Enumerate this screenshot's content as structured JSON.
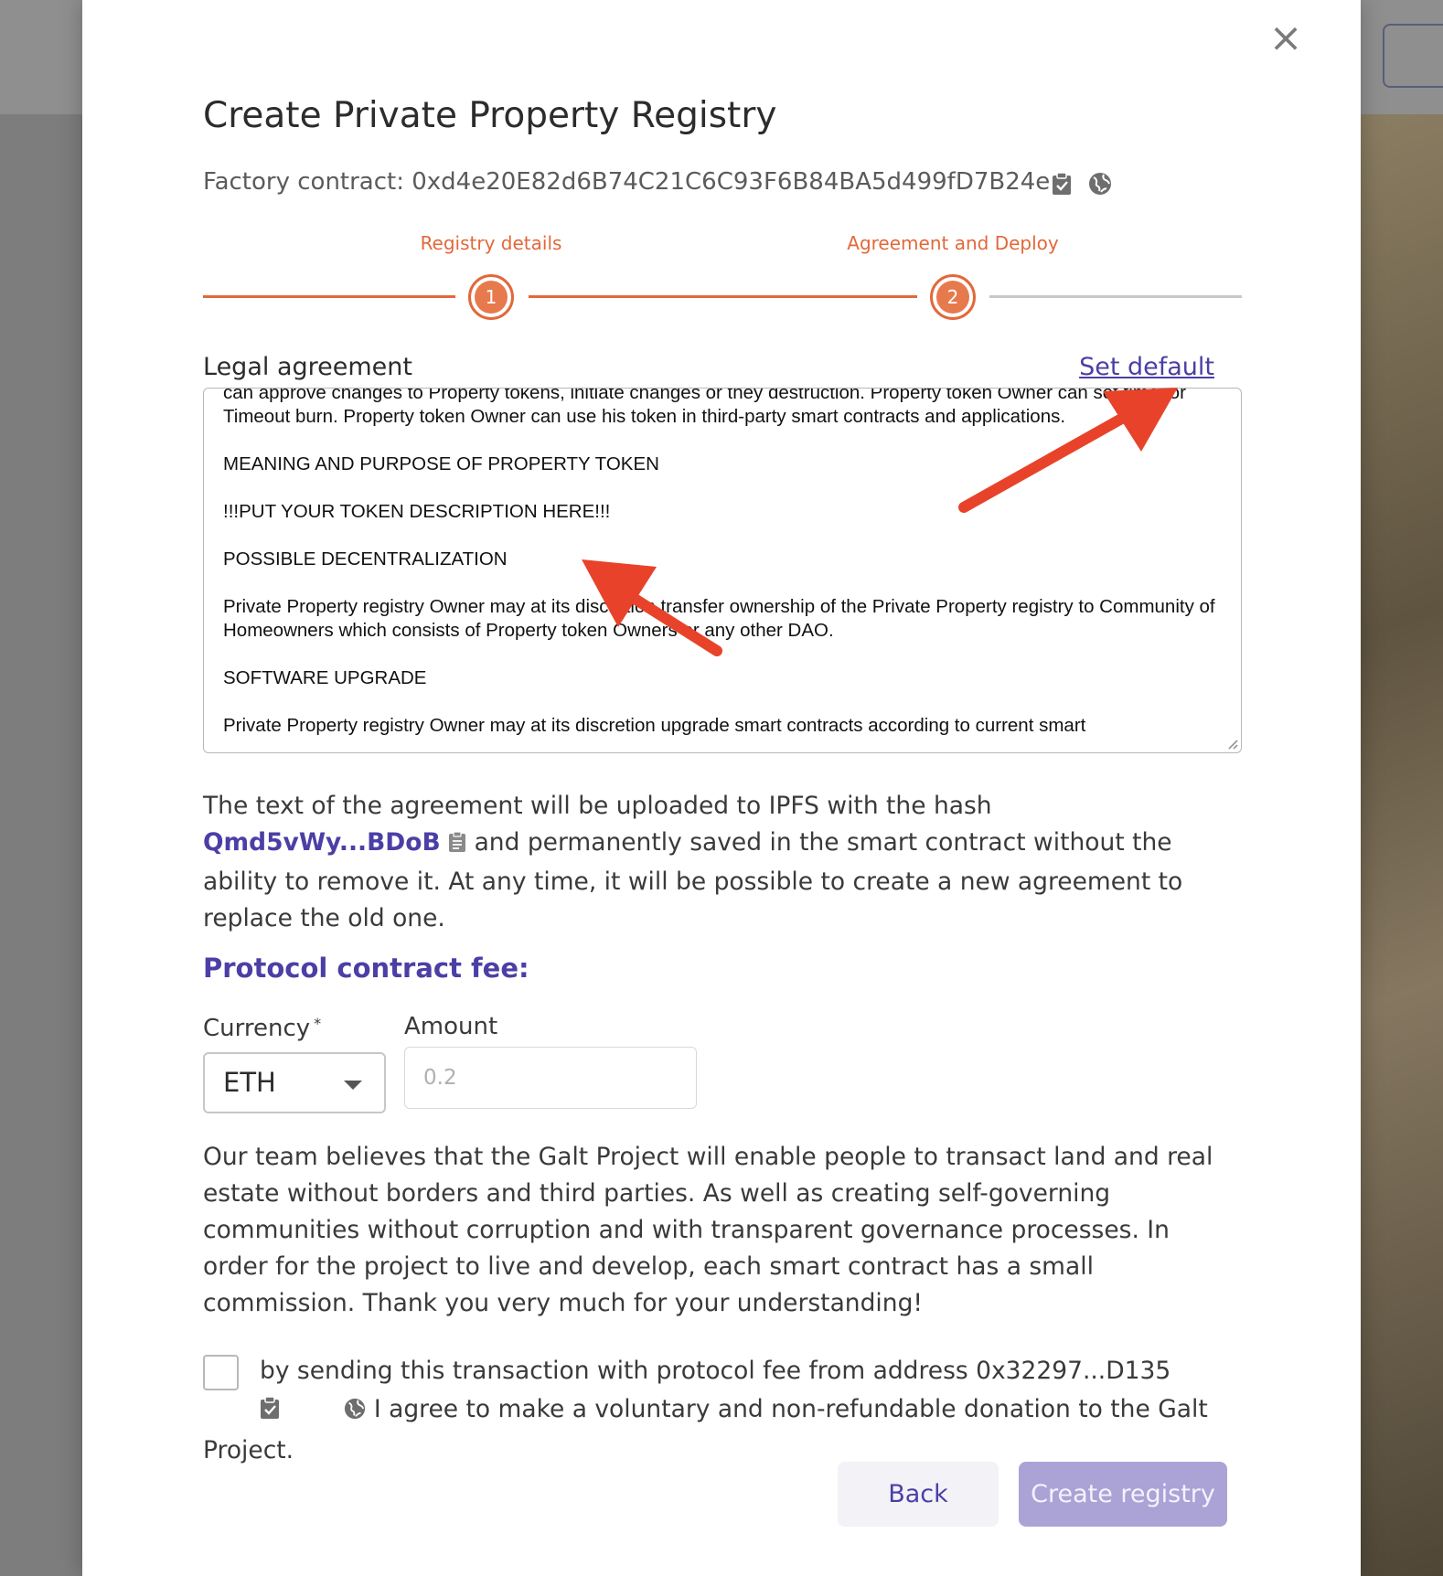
{
  "modal": {
    "title": "Create Private Property Registry",
    "factory_contract": "Factory contract: 0xd4e20E82d6B74C21C6C93F6B84BA5d499fD7B24e",
    "copy_icon": "clipboard-check-icon",
    "explorer_icon": "globe-icon",
    "close_icon": "close-icon",
    "close_glyph": "×"
  },
  "stepper": {
    "steps": [
      {
        "label": "Registry details",
        "number": "1"
      },
      {
        "label": "Agreement and Deploy",
        "number": "2"
      }
    ],
    "active_step": 2,
    "accent_color": "#e2683a"
  },
  "agreement": {
    "label": "Legal agreement",
    "set_default": "Set default",
    "paragraphs": [
      "can approve changes to Property tokens, initiate changes or they destruction. Property token Owner can set time for Timeout burn. Property token Owner can use his token in third-party smart contracts and applications.",
      "MEANING AND PURPOSE OF PROPERTY TOKEN",
      "!!!PUT YOUR TOKEN DESCRIPTION HERE!!!",
      "POSSIBLE DECENTRALIZATION",
      "Private Property registry Owner may at its discretion transfer ownership of the Private Property registry to Community of Homeowners which consists of Property token Owners or any other DAO.",
      "SOFTWARE UPGRADE",
      "Private Property registry Owner may at its discretion upgrade smart contracts according to current smart"
    ],
    "ipfs_prefix": "The text of the agreement will be uploaded to IPFS with the hash ",
    "ipfs_hash": "Qmd5vWy...BDoB",
    "ipfs_suffix": " and permanently saved in the smart contract without the ability to remove it. At any time, it will be possible to create a new agreement to replace the old one.",
    "hash_copy_icon": "clipboard-icon"
  },
  "fee": {
    "title": "Protocol contract fee:",
    "currency_label": "Currency",
    "required_mark": "*",
    "currency_value": "ETH",
    "amount_label": "Amount",
    "amount_placeholder": "0.2",
    "note": "Our team believes that the Galt Project will enable people to transact land and real estate without borders and third parties. As well as creating self-governing communities without corruption and with transparent governance processes. In order for the project to live and develop, each smart contract has a small commission. Thank you very much for your understanding!"
  },
  "consent": {
    "prefix": "by sending this transaction with protocol fee from address 0x32297...D135",
    "suffix": " I agree to make a voluntary and non-refundable donation to the Galt Project.",
    "checked": false
  },
  "buttons": {
    "back": "Back",
    "create": "Create registry"
  },
  "annotations": {
    "arrow_color": "#e8432a"
  }
}
